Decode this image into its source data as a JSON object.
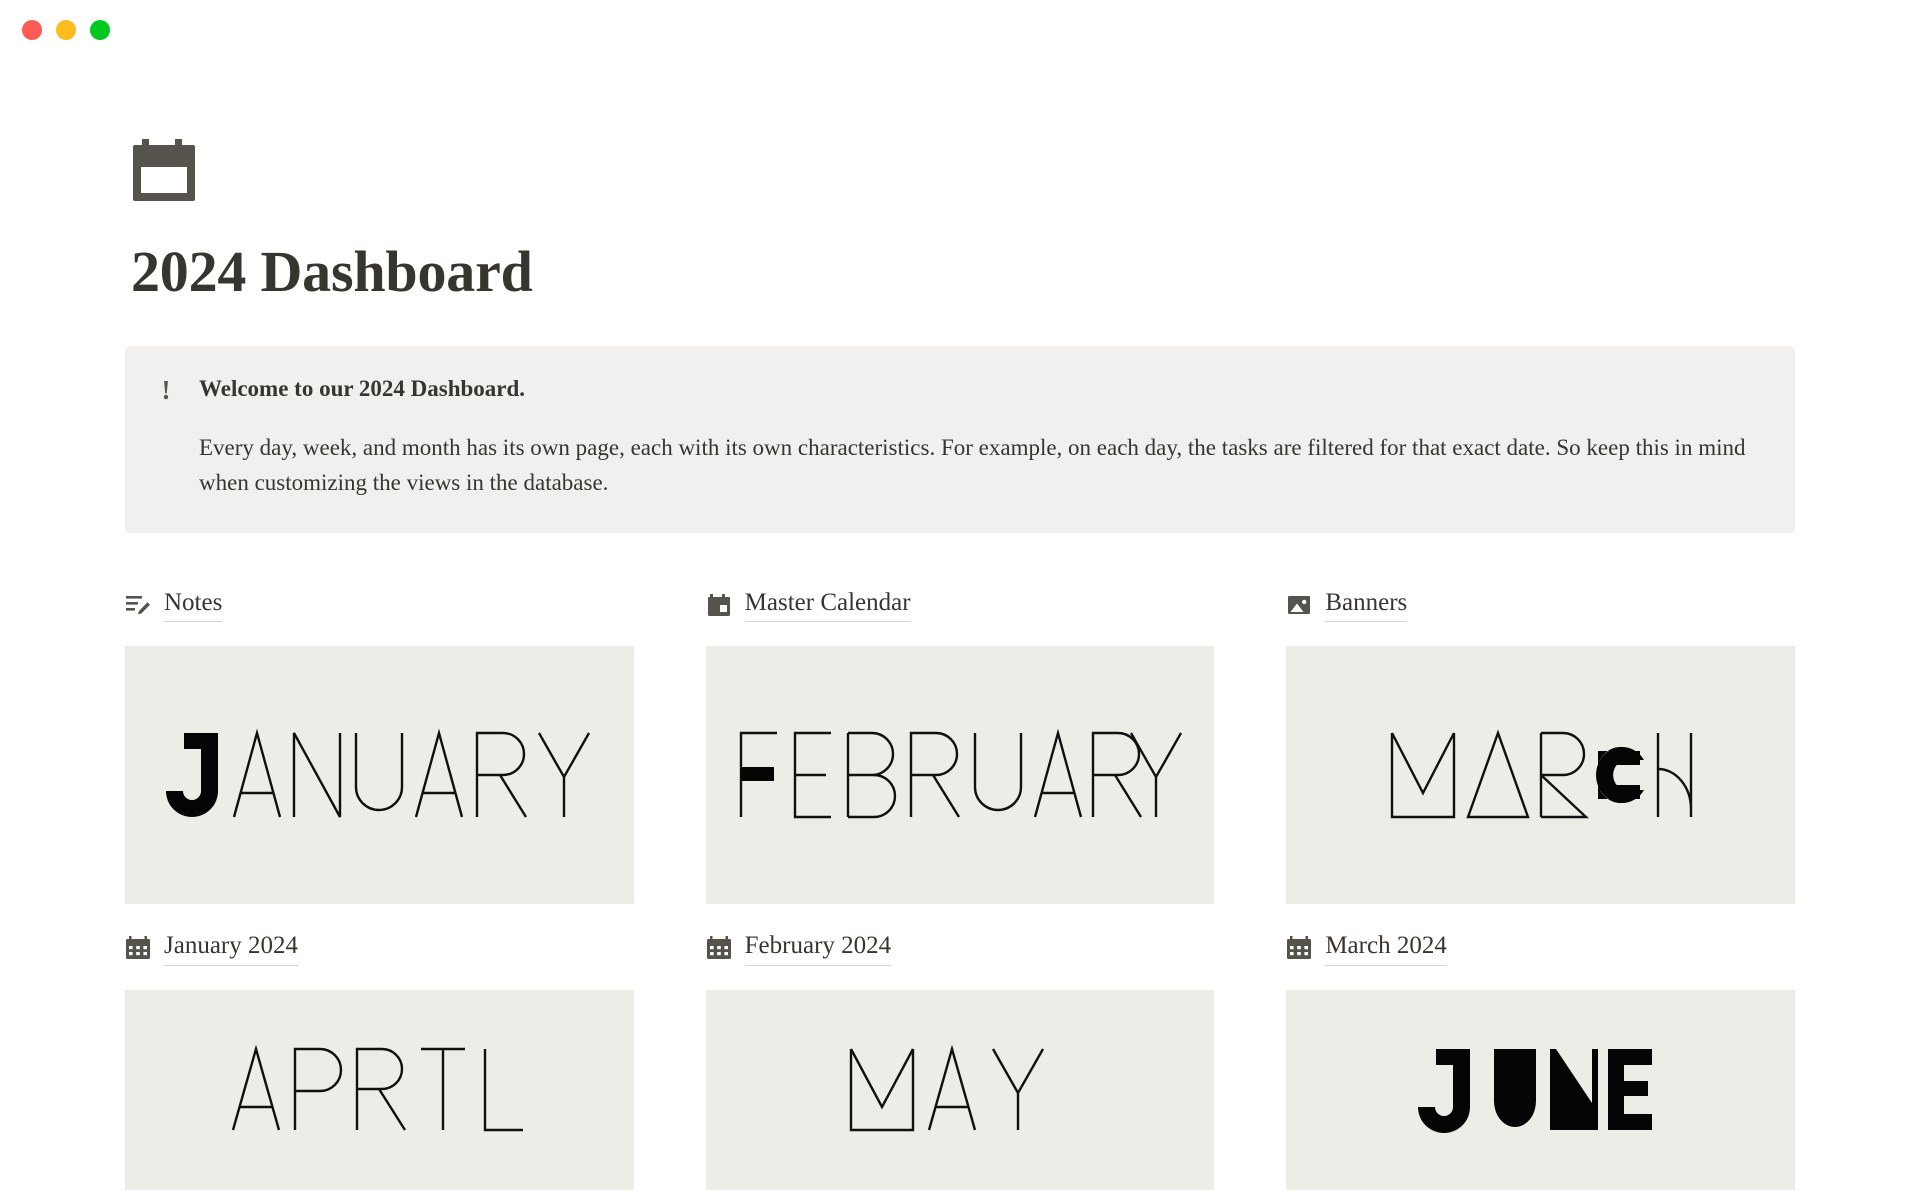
{
  "window": {
    "controls": [
      {
        "name": "close",
        "color": "#ff5b54"
      },
      {
        "name": "minimize",
        "color": "#ffbc1f"
      },
      {
        "name": "maximize",
        "color": "#00c81f"
      }
    ]
  },
  "page": {
    "icon": "calendar-icon",
    "title": "2024 Dashboard"
  },
  "callout": {
    "icon": "exclamation-icon",
    "heading": "Welcome to our 2024 Dashboard.",
    "text": "Every day, week, and month has its own page, each with its own characteristics. For example, on each day, the tasks are filtered for that exact date. So keep this in mind when customizing the views in the database."
  },
  "columns": [
    {
      "header_link": {
        "icon": "notes-edit-icon",
        "label": "Notes"
      },
      "banner": {
        "word": "JANUARY",
        "bold_letters": [
          0
        ]
      },
      "month_link": {
        "icon": "calendar-grid-icon",
        "label": "January 2024"
      },
      "banner2": {
        "word": "APRIL",
        "bold_letters": []
      }
    },
    {
      "header_link": {
        "icon": "calendar-small-icon",
        "label": "Master Calendar"
      },
      "banner": {
        "word": "FEBRUARY",
        "bold_letters": [
          0
        ]
      },
      "month_link": {
        "icon": "calendar-grid-icon",
        "label": "February 2024"
      },
      "banner2": {
        "word": "MAY",
        "bold_letters": []
      }
    },
    {
      "header_link": {
        "icon": "image-icon",
        "label": "Banners"
      },
      "banner": {
        "word": "MARCH",
        "bold_letters": [
          3
        ]
      },
      "month_link": {
        "icon": "calendar-grid-icon",
        "label": "March 2024"
      },
      "banner2": {
        "word": "JUNE",
        "bold_letters": [
          0,
          1,
          2,
          3
        ]
      }
    }
  ],
  "colors": {
    "page_background": "#ffffff",
    "callout_background": "#f1f0ee",
    "banner_background": "#edede7",
    "text": "#37352f",
    "icon_dark": "#55534c",
    "link_underline": "#d6d4d0"
  }
}
